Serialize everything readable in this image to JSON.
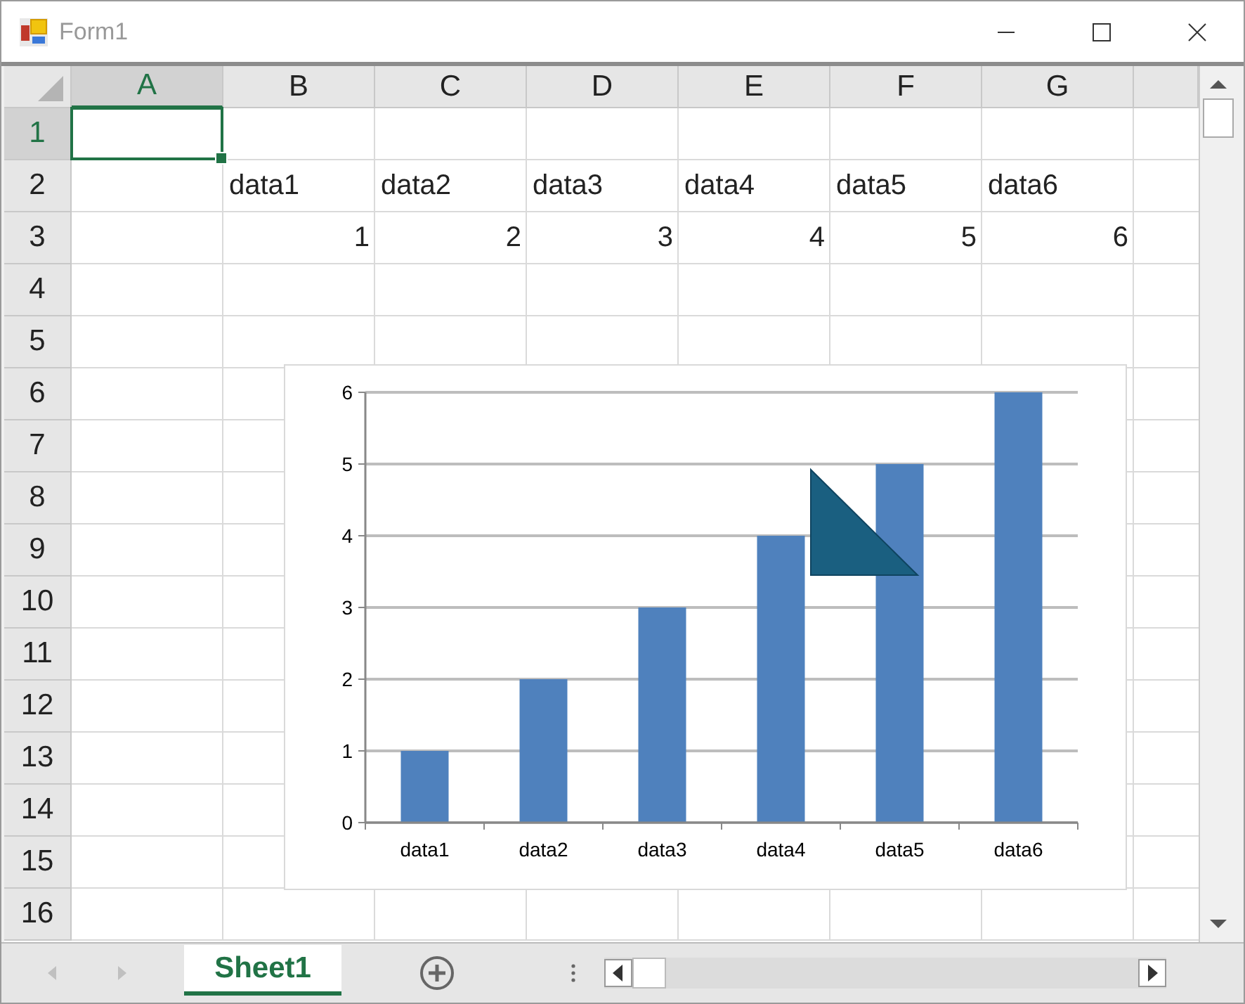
{
  "window": {
    "title": "Form1"
  },
  "columns": [
    {
      "label": "A",
      "selected": true
    },
    {
      "label": "B",
      "selected": false
    },
    {
      "label": "C",
      "selected": false
    },
    {
      "label": "D",
      "selected": false
    },
    {
      "label": "E",
      "selected": false
    },
    {
      "label": "F",
      "selected": false
    },
    {
      "label": "G",
      "selected": false
    }
  ],
  "rows": [
    {
      "label": "1",
      "selected": true
    },
    {
      "label": "2",
      "selected": false,
      "kind": "text",
      "cells": [
        null,
        "data1",
        "data2",
        "data3",
        "data4",
        "data5",
        "data6"
      ]
    },
    {
      "label": "3",
      "selected": false,
      "kind": "number",
      "cells": [
        null,
        "1",
        "2",
        "3",
        "4",
        "5",
        "6"
      ]
    },
    {
      "label": "4",
      "selected": false
    },
    {
      "label": "5",
      "selected": false
    },
    {
      "label": "6",
      "selected": false
    },
    {
      "label": "7",
      "selected": false
    },
    {
      "label": "8",
      "selected": false
    },
    {
      "label": "9",
      "selected": false
    },
    {
      "label": "10",
      "selected": false
    },
    {
      "label": "11",
      "selected": false
    },
    {
      "label": "12",
      "selected": false
    },
    {
      "label": "13",
      "selected": false
    },
    {
      "label": "14",
      "selected": false
    },
    {
      "label": "15",
      "selected": false
    },
    {
      "label": "16",
      "selected": false
    }
  ],
  "chart": {
    "chart_data": {
      "type": "bar",
      "categories": [
        "data1",
        "data2",
        "data3",
        "data4",
        "data5",
        "data6"
      ],
      "series": [
        {
          "color": "#4f81bd",
          "values": [
            1,
            2,
            3,
            4,
            5,
            6
          ]
        }
      ],
      "grid": true,
      "ylim": [
        0,
        6
      ],
      "yticks": [
        0,
        1,
        2,
        3,
        4,
        5,
        6
      ]
    }
  },
  "shapes": [
    {
      "kind": "right-triangle",
      "color": "#1a5f80"
    }
  ],
  "sheet_tabs": [
    {
      "label": "Sheet1",
      "selected": true
    }
  ]
}
